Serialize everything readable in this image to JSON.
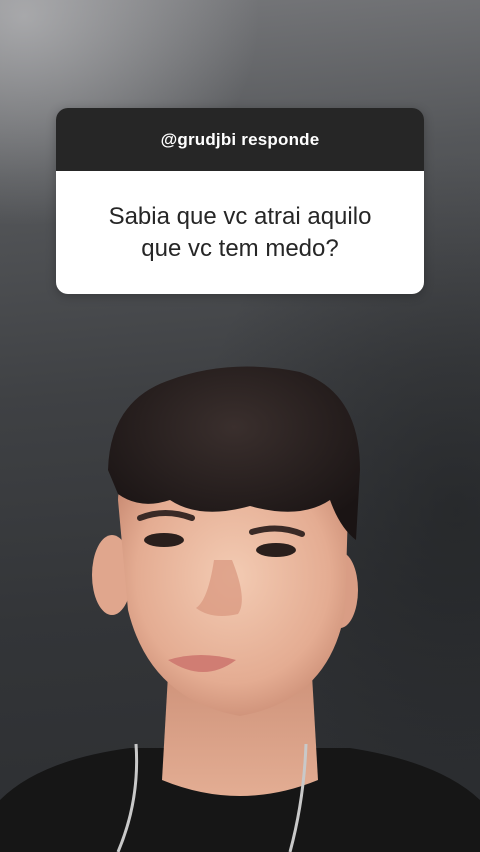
{
  "story": {
    "question_sticker": {
      "header": "@grudjbi responde",
      "question_lines": [
        "Sabia que vc atrai aquilo",
        "que vc tem medo?"
      ]
    },
    "photo": {
      "subject": "person-selfie"
    }
  },
  "colors": {
    "sticker_header_bg": "#262626",
    "sticker_body_bg": "#ffffff",
    "sticker_text": "#262626",
    "wall": "#3f4144"
  }
}
